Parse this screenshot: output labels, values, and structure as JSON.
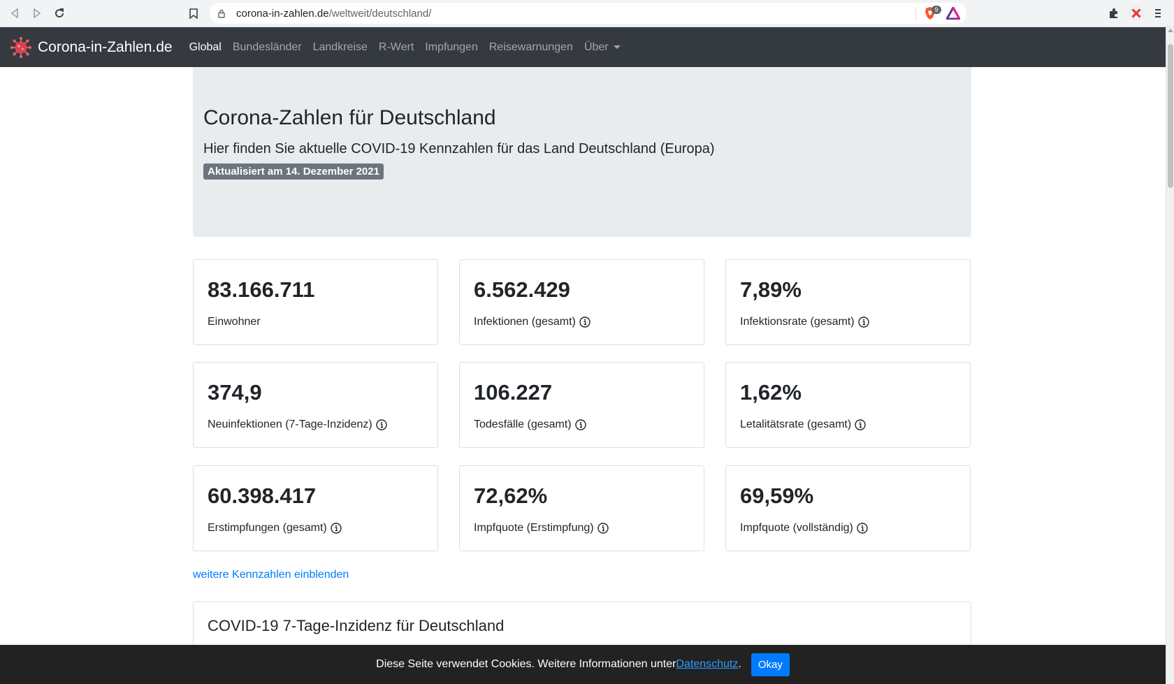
{
  "browser": {
    "url_host": "corona-in-zahlen.de",
    "url_path": "/weltweit/deutschland/",
    "extension_badge": "9"
  },
  "navbar": {
    "brand": "Corona-in-Zahlen.de",
    "links": [
      "Global",
      "Bundesländer",
      "Landkreise",
      "R-Wert",
      "Impfungen",
      "Reisewarnungen",
      "Über"
    ],
    "active": "Global"
  },
  "jumbotron": {
    "title": "Corona-Zahlen für Deutschland",
    "lead": "Hier finden Sie aktuelle COVID-19 Kennzahlen für das Land Deutschland (Europa)",
    "badge": "Aktualisiert am 14. Dezember 2021"
  },
  "stats": [
    {
      "value": "83.166.711",
      "label": "Einwohner",
      "info": false
    },
    {
      "value": "6.562.429",
      "label": "Infektionen (gesamt)",
      "info": true
    },
    {
      "value": "7,89%",
      "label": "Infektionsrate (gesamt)",
      "info": true
    },
    {
      "value": "374,9",
      "label": "Neuinfektionen (7-Tage-Inzidenz)",
      "info": true
    },
    {
      "value": "106.227",
      "label": "Todesfälle (gesamt)",
      "info": true
    },
    {
      "value": "1,62%",
      "label": "Letalitätsrate (gesamt)",
      "info": true
    },
    {
      "value": "60.398.417",
      "label": "Erstimpfungen (gesamt)",
      "info": true
    },
    {
      "value": "72,62%",
      "label": "Impfquote (Erstimpfung)",
      "info": true
    },
    {
      "value": "69,59%",
      "label": "Impfquote (vollständig)",
      "info": true
    }
  ],
  "more_link": "weitere Kennzahlen einblenden",
  "chart_card_title": "COVID-19 7-Tage-Inzidenz für Deutschland",
  "cookie": {
    "text": "Diese Seite verwendet Cookies. Weitere Informationen unter ",
    "link": "Datenschutz",
    "dot": ".",
    "button": "Okay"
  },
  "colors": {
    "navbar_bg": "#343a40",
    "jumbotron_bg": "#e9ecef",
    "link": "#007bff",
    "badge_bg": "#6c757d",
    "cookie_bg": "#222222"
  }
}
